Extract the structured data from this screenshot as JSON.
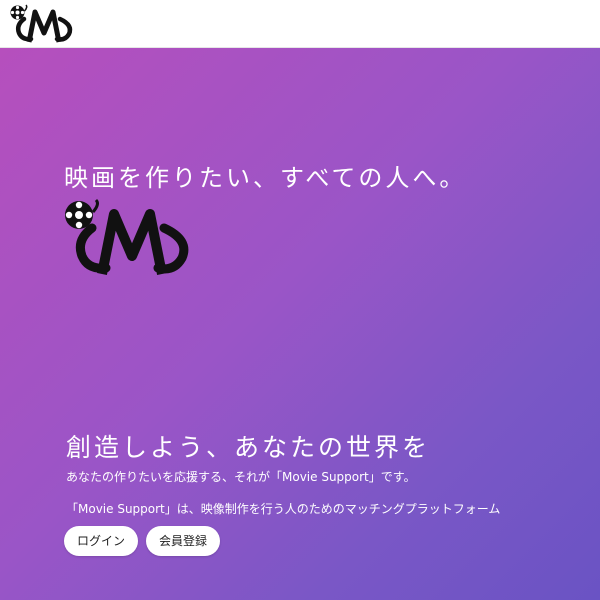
{
  "header": {
    "logo_alt": "Movie Support"
  },
  "hero": {
    "tagline": "映画を作りたい、すべての人へ。",
    "logo_alt": "Movie Support",
    "headline": "創造しよう、あなたの世界を",
    "subline": "あなたの作りたいを応援する、それが「Movie Support」です。",
    "description": "「Movie Support」は、映像制作を行う人のためのマッチングプラットフォーム",
    "buttons": {
      "login": "ログイン",
      "register": "会員登録"
    }
  },
  "colors": {
    "gradient_start": "#b64fbd",
    "gradient_end": "#6a53c4",
    "logo_ink": "#111111"
  },
  "icons": [
    "film-reel-icon",
    "movie-support-logo"
  ]
}
